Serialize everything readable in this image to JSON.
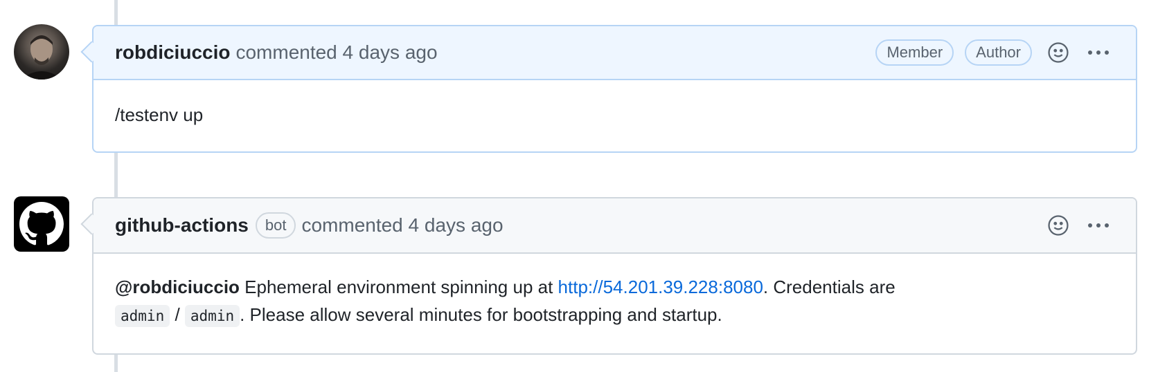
{
  "comments": [
    {
      "author": "robdiciuccio",
      "meta": "commented 4 days ago",
      "badges": [
        "Member",
        "Author"
      ],
      "body": "/testenv up",
      "header_bg": "#eef6ff",
      "border_color": "#b6d4f5"
    },
    {
      "author": "github-actions",
      "bot_label": "bot",
      "meta": "commented 4 days ago",
      "body": {
        "mention": "@robdiciuccio",
        "text1": " Ephemeral environment spinning up at ",
        "link": "http://54.201.39.228:8080",
        "text2": ". Credentials are",
        "code1": "admin",
        "separator": " / ",
        "code2": "admin",
        "text3": ". Please allow several minutes for bootstrapping and startup."
      },
      "header_bg": "#f6f8fa",
      "border_color": "#d0d7de"
    }
  ],
  "icons": {
    "reaction": "smiley-icon",
    "more": "kebab-horizontal-icon",
    "bot_avatar": "github-octocat-icon"
  },
  "colors": {
    "link": "#0969da",
    "muted": "#59636e",
    "timeline": "#d8dee4"
  }
}
